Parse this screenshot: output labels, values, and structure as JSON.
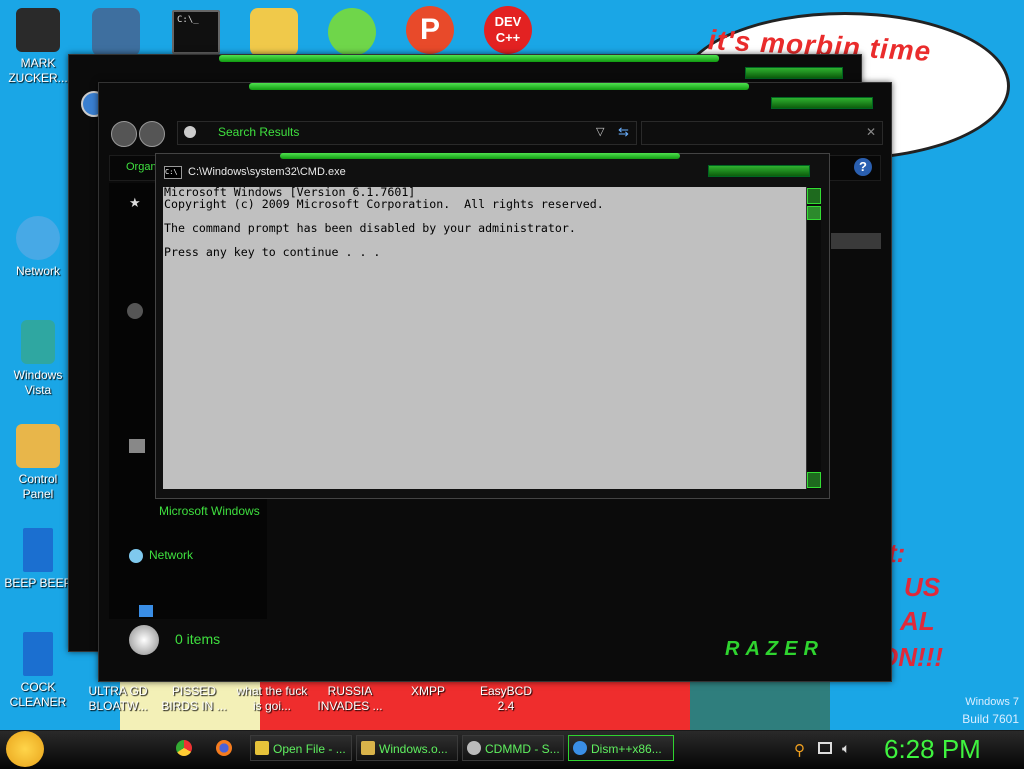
{
  "desktop": {
    "bubble_text": "it's morbin time",
    "red_text": [
      "t:",
      "US",
      "AL",
      "ON!!!"
    ],
    "os_edition": "Windows 7",
    "os_build": "Build 7601",
    "left_icons": [
      {
        "label": "MARK ZUCKER...",
        "color": "#2a2a2a"
      },
      {
        "label": "Network",
        "color": "#47a9e6"
      },
      {
        "label": "Windows Vista",
        "color": "#2fa7a1"
      },
      {
        "label": "Control Panel",
        "color": "#e8b64a"
      },
      {
        "label": "BEEP BEEP",
        "color": "#1b6fd0"
      },
      {
        "label": "COCK CLEANER",
        "color": "#1b6fd0"
      }
    ],
    "bottom_icons": [
      {
        "label": "ULTRA GD BLOATW..."
      },
      {
        "label": "PISSED BIRDS IN ..."
      },
      {
        "label": "what the fuck is goi..."
      },
      {
        "label": "RUSSIA INVADES ..."
      },
      {
        "label": "XMPP"
      },
      {
        "label": "EasyBCD 2.4"
      }
    ],
    "top_icons": [
      {
        "name": "folder",
        "color": "#3e6f9f"
      },
      {
        "name": "notepad",
        "color": "#6fa8d8"
      },
      {
        "name": "cmd",
        "color": "#101010"
      },
      {
        "name": "drive",
        "color": "#f0c94a"
      },
      {
        "name": "pig",
        "color": "#6fd64a"
      },
      {
        "name": "p-logo",
        "color": "#e84a2a"
      },
      {
        "name": "dev-cpp",
        "color": "#e32222"
      }
    ],
    "dev_label": "DEV C++"
  },
  "explorer": {
    "address": "Search Results",
    "organize": "Organ",
    "sidebar": {
      "item_ms": "Microsoft Windows",
      "network": "Network"
    },
    "status": "0 items",
    "brand": "RAZER",
    "help": "?"
  },
  "cmd": {
    "title": "C:\\Windows\\system32\\CMD.exe",
    "lines": [
      "Microsoft Windows [Version 6.1.7601]",
      "Copyright (c) 2009 Microsoft Corporation.  All rights reserved.",
      "",
      "The command prompt has been disabled by your administrator.",
      "",
      "Press any key to continue . . ."
    ]
  },
  "taskbar": {
    "buttons": [
      {
        "label": "Open File - ...",
        "icon_color": "#e6c23a"
      },
      {
        "label": "Windows.o...",
        "icon_color": "#d9b34a"
      },
      {
        "label": "CDMMD - S...",
        "icon_color": "#bbbbbb"
      },
      {
        "label": "Dism++x86...",
        "icon_color": "#3a8ee6"
      }
    ],
    "clock": "6:28 PM"
  }
}
